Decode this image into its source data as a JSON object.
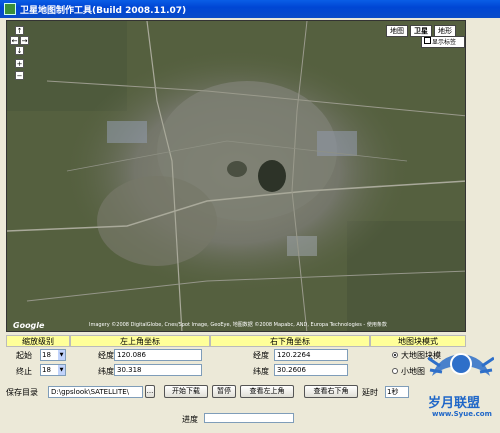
{
  "window": {
    "title": "卫星地图制作工具(Build 2008.11.07)"
  },
  "map": {
    "types": [
      "地图",
      "卫星",
      "地形"
    ],
    "selected_type": "卫星",
    "show_labels": "显示标签",
    "show_labels_checked": true,
    "nav": {
      "up": "↑",
      "left": "←",
      "right": "→",
      "down": "↓",
      "zoom_in": "+",
      "zoom_out": "−"
    },
    "copyright": "Imagery ©2008 DigitalGlobe, Cnes/Spot Image, GeoEye, 地图数据 ©2008 Mapabc, AND, Europa Technologies - 使用条款",
    "logo": "Google"
  },
  "headers": {
    "zoom": "缩放级别",
    "top_left": "左上角坐标",
    "bottom_right": "右下角坐标",
    "tile_mode": "地图块模式"
  },
  "zoom": {
    "start_label": "起始",
    "start_value": "18",
    "end_label": "终止",
    "end_value": "18"
  },
  "top_left": {
    "lon_label": "经度",
    "lon_value": "120.086",
    "lat_label": "纬度",
    "lat_value": "30.318"
  },
  "bottom_right": {
    "lon_label": "经度",
    "lon_value": "120.2264",
    "lat_label": "纬度",
    "lat_value": "30.2606"
  },
  "tile_mode": {
    "options": [
      "大地图块模",
      "小地图"
    ],
    "selected": 0
  },
  "save": {
    "label": "保存目录",
    "path": "D:\\gpslook\\SATELLITE\\",
    "browse": "..."
  },
  "buttons": {
    "start": "开始下载",
    "pause": "暂停",
    "view_top_left": "查看左上角",
    "view_bottom_right": "查看右下角"
  },
  "delay": {
    "label": "延时",
    "value": "1秒"
  },
  "progress": {
    "label": "进度",
    "value": 0
  },
  "watermark": {
    "site": "岁月联盟",
    "url": "www.Syue.com"
  }
}
